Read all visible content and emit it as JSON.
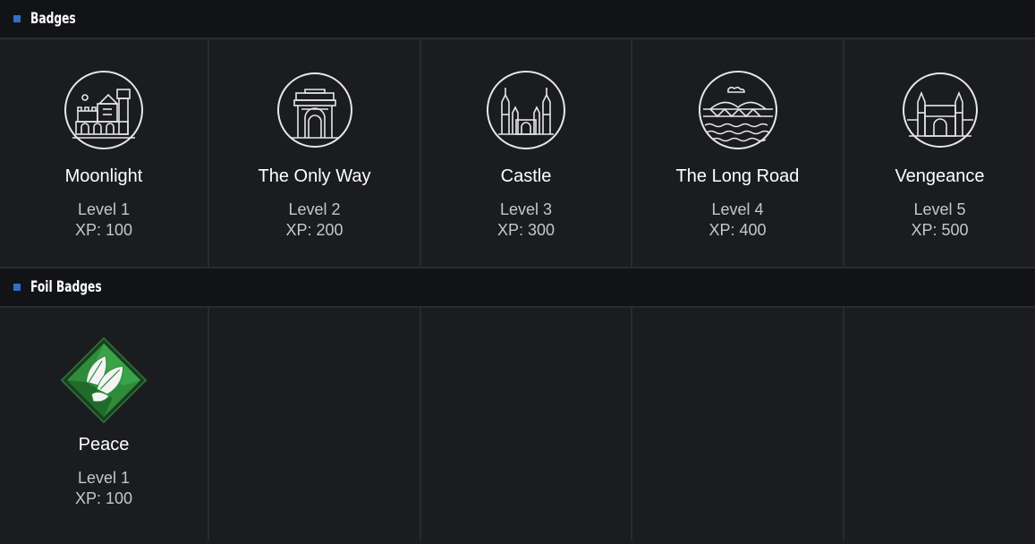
{
  "sections": [
    {
      "title": "Badges",
      "badges": [
        {
          "name": "Moonlight",
          "level": "Level 1",
          "xp": "XP: 100",
          "icon": "fort-icon"
        },
        {
          "name": "The Only Way",
          "level": "Level 2",
          "xp": "XP: 200",
          "icon": "gate-icon"
        },
        {
          "name": "Castle",
          "level": "Level 3",
          "xp": "XP: 300",
          "icon": "castle-icon"
        },
        {
          "name": "The Long Road",
          "level": "Level 4",
          "xp": "XP: 400",
          "icon": "bridge-icon"
        },
        {
          "name": "Vengeance",
          "level": "Level 5",
          "xp": "XP: 500",
          "icon": "monument-icon"
        }
      ]
    },
    {
      "title": "Foil Badges",
      "badges": [
        {
          "name": "Peace",
          "level": "Level 1",
          "xp": "XP: 100",
          "icon": "leaf-icon"
        }
      ]
    }
  ],
  "colors": {
    "background": "#1b1c20",
    "header_background": "#121316",
    "accent": "#2f6fc4",
    "foil_green": "#2e8b3a"
  }
}
